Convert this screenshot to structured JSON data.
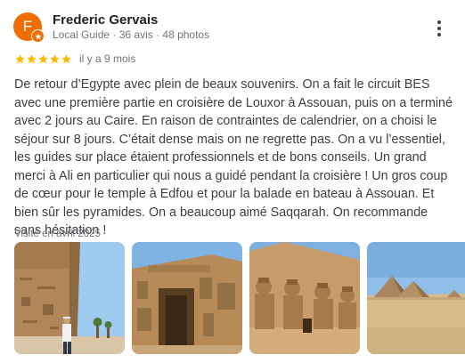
{
  "reviewer": {
    "initial": "F",
    "name": "Frederic Gervais",
    "meta": "Local Guide · 36 avis · 48 photos"
  },
  "rating": {
    "stars": 5,
    "max": 5,
    "time": "il y a 9 mois"
  },
  "review": {
    "text": "De retour d’Egypte avec plein de beaux souvenirs. On a fait le circuit BES avec une première partie en croisière de Louxor à Assouan, puis on a terminé avec 2 jours au Caire. En raison de contraintes de calendrier, on a choisi le séjour sur 8 jours. C’était dense mais on ne regrette pas. On a vu l’essentiel, les guides sur place étaient professionnels et de bons conseils. Un grand merci à Ali en particulier qui nous a guidé pendant la croisière ! Un gros coup de cœur pour le temple à Edfou et pour la balade en bateau à Assouan. Et bien sûr les pyramides. On a beaucoup aimé Saqqarah. On recommande sans hésitation !"
  },
  "visit": "Visité en avril 2025",
  "colors": {
    "avatar": "#ef6c00",
    "star": "#fbbc04",
    "meta": "#70757a",
    "text": "#3c4043"
  },
  "icons": {
    "menu": "more-vert-icon",
    "star": "star-icon",
    "badge": "local-guide-badge-icon"
  }
}
